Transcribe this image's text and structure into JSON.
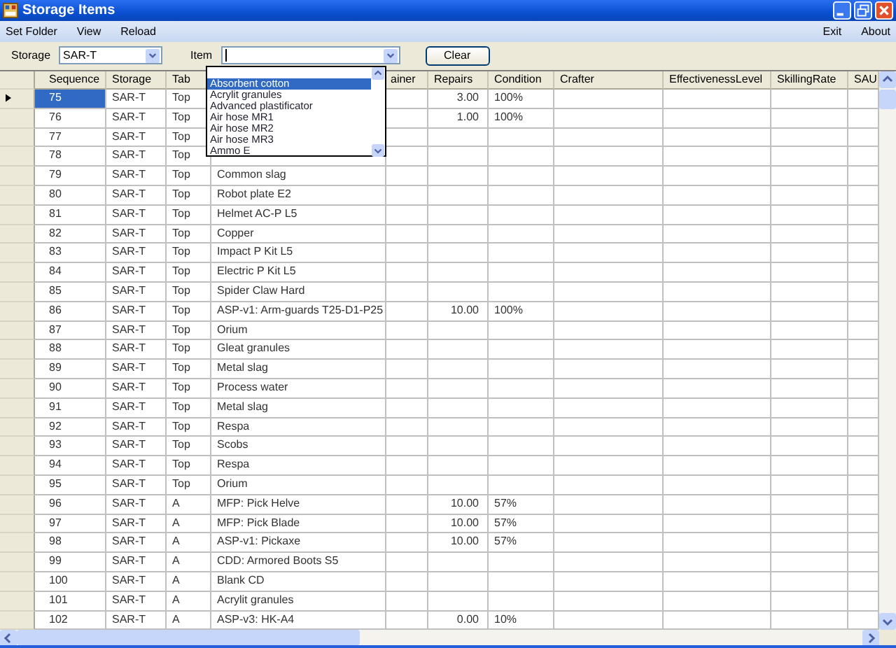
{
  "window": {
    "title": "Storage Items"
  },
  "menu": {
    "left": [
      "Set Folder",
      "View",
      "Reload"
    ],
    "right": [
      "Exit",
      "About"
    ]
  },
  "toolbar": {
    "storage_label": "Storage",
    "storage_value": "SAR-T",
    "item_label": "Item",
    "clear_button": "Clear"
  },
  "item_dropdown": {
    "options": [
      {
        "label": "Absorbent cotton",
        "selected": true
      },
      {
        "label": "Acrylit granules",
        "selected": false
      },
      {
        "label": "Advanced plastificator",
        "selected": false
      },
      {
        "label": "Air hose MR1",
        "selected": false
      },
      {
        "label": "Air hose MR2",
        "selected": false
      },
      {
        "label": "Air hose MR3",
        "selected": false
      },
      {
        "label": "Ammo E",
        "selected": false
      }
    ]
  },
  "table": {
    "columns": [
      "Sequence",
      "Storage",
      "Tab",
      null,
      "ainer",
      "Repairs",
      "Condition",
      "Crafter",
      "EffectivenessLevel",
      "SkillingRate",
      "SAU"
    ],
    "rows": [
      {
        "sequence": "75",
        "storage": "SAR-T",
        "tab": "Top",
        "repairs": "3.00",
        "condition": "100%",
        "selected": true
      },
      {
        "sequence": "76",
        "storage": "SAR-T",
        "tab": "Top",
        "repairs": "1.00",
        "condition": "100%",
        "selected": false
      },
      {
        "sequence": "77",
        "storage": "SAR-T",
        "tab": "Top",
        "selected": false
      },
      {
        "sequence": "78",
        "storage": "SAR-T",
        "tab": "Top",
        "selected": false
      },
      {
        "sequence": "79",
        "storage": "SAR-T",
        "tab": "Top",
        "item": "Common slag",
        "selected": false
      },
      {
        "sequence": "80",
        "storage": "SAR-T",
        "tab": "Top",
        "item": "Robot plate E2",
        "selected": false
      },
      {
        "sequence": "81",
        "storage": "SAR-T",
        "tab": "Top",
        "item": "Helmet AC-P L5",
        "selected": false
      },
      {
        "sequence": "82",
        "storage": "SAR-T",
        "tab": "Top",
        "item": "Copper",
        "selected": false
      },
      {
        "sequence": "83",
        "storage": "SAR-T",
        "tab": "Top",
        "item": "Impact P Kit L5",
        "selected": false
      },
      {
        "sequence": "84",
        "storage": "SAR-T",
        "tab": "Top",
        "item": "Electric P Kit L5",
        "selected": false
      },
      {
        "sequence": "85",
        "storage": "SAR-T",
        "tab": "Top",
        "item": "Spider Claw Hard",
        "selected": false
      },
      {
        "sequence": "86",
        "storage": "SAR-T",
        "tab": "Top",
        "item": "ASP-v1: Arm-guards T25-D1-P25",
        "repairs": "10.00",
        "condition": "100%",
        "selected": false
      },
      {
        "sequence": "87",
        "storage": "SAR-T",
        "tab": "Top",
        "item": "Orium",
        "selected": false
      },
      {
        "sequence": "88",
        "storage": "SAR-T",
        "tab": "Top",
        "item": "Gleat granules",
        "selected": false
      },
      {
        "sequence": "89",
        "storage": "SAR-T",
        "tab": "Top",
        "item": "Metal slag",
        "selected": false
      },
      {
        "sequence": "90",
        "storage": "SAR-T",
        "tab": "Top",
        "item": "Process water",
        "selected": false
      },
      {
        "sequence": "91",
        "storage": "SAR-T",
        "tab": "Top",
        "item": "Metal slag",
        "selected": false
      },
      {
        "sequence": "92",
        "storage": "SAR-T",
        "tab": "Top",
        "item": "Respa",
        "selected": false
      },
      {
        "sequence": "93",
        "storage": "SAR-T",
        "tab": "Top",
        "item": "Scobs",
        "selected": false
      },
      {
        "sequence": "94",
        "storage": "SAR-T",
        "tab": "Top",
        "item": "Respa",
        "selected": false
      },
      {
        "sequence": "95",
        "storage": "SAR-T",
        "tab": "Top",
        "item": "Orium",
        "selected": false
      },
      {
        "sequence": "96",
        "storage": "SAR-T",
        "tab": "A",
        "item": "MFP: Pick Helve",
        "repairs": "10.00",
        "condition": "57%",
        "selected": false
      },
      {
        "sequence": "97",
        "storage": "SAR-T",
        "tab": "A",
        "item": "MFP: Pick Blade",
        "repairs": "10.00",
        "condition": "57%",
        "selected": false
      },
      {
        "sequence": "98",
        "storage": "SAR-T",
        "tab": "A",
        "item": "ASP-v1: Pickaxe",
        "repairs": "10.00",
        "condition": "57%",
        "selected": false
      },
      {
        "sequence": "99",
        "storage": "SAR-T",
        "tab": "A",
        "item": "CDD: Armored Boots S5",
        "selected": false
      },
      {
        "sequence": "100",
        "storage": "SAR-T",
        "tab": "A",
        "item": "Blank CD",
        "selected": false
      },
      {
        "sequence": "101",
        "storage": "SAR-T",
        "tab": "A",
        "item": "Acrylit granules",
        "selected": false
      },
      {
        "sequence": "102",
        "storage": "SAR-T",
        "tab": "A",
        "item": "ASP-v3: HK-A4",
        "repairs": "0.00",
        "condition": "10%",
        "selected": false
      }
    ]
  }
}
